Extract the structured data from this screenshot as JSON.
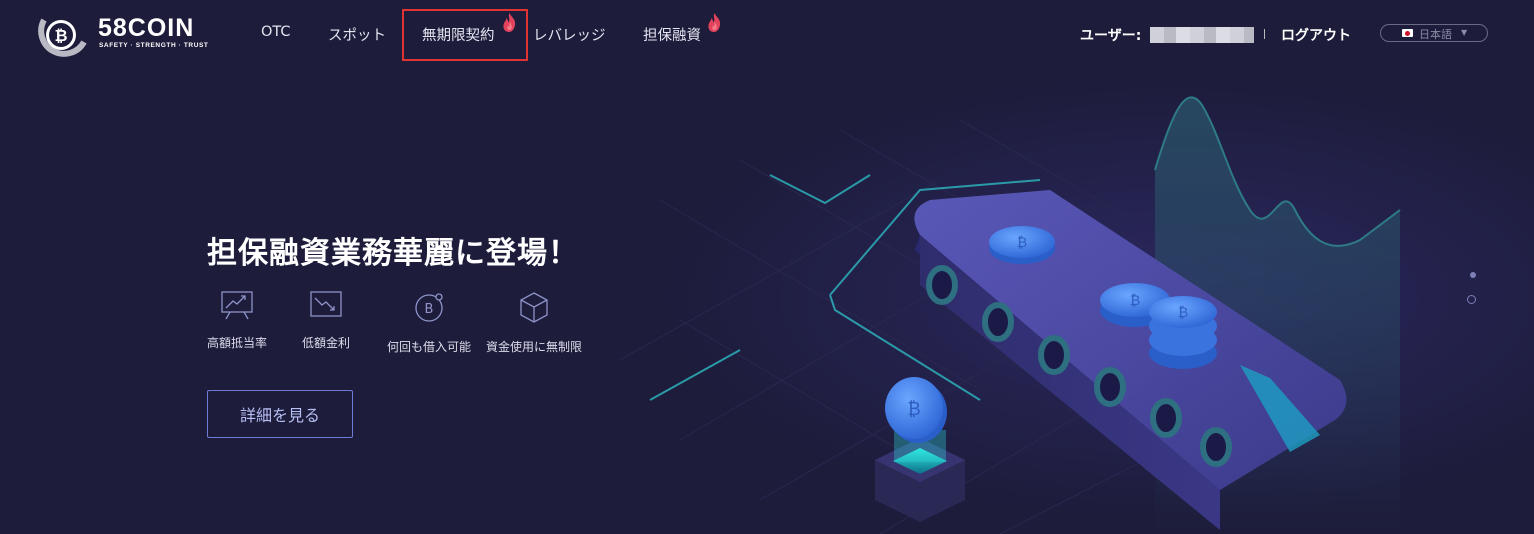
{
  "brand": {
    "name": "58COIN",
    "tagline": "SAFETY · STRENGTH · TRUST"
  },
  "nav": {
    "items": [
      {
        "label": "OTC"
      },
      {
        "label": "スポット"
      },
      {
        "label": "無期限契約",
        "hot": true,
        "highlighted": true
      },
      {
        "label": "レバレッジ"
      },
      {
        "label": "担保融資",
        "hot": true
      }
    ]
  },
  "user": {
    "label": "ユーザー:",
    "name_redacted": true,
    "logout_label": "ログアウト"
  },
  "language": {
    "selected": "日本語"
  },
  "hero": {
    "title": "担保融資業務華麗に登場！",
    "features": [
      {
        "icon": "chart-up-icon",
        "label": "高額抵当率"
      },
      {
        "icon": "chart-down-icon",
        "label": "低額金利"
      },
      {
        "icon": "bitcoin-cycle-icon",
        "label": "何回も借入可能"
      },
      {
        "icon": "cube-icon",
        "label": "資金使用に無制限"
      }
    ],
    "cta_label": "詳細を見る"
  },
  "carousel": {
    "slides": 2,
    "active": 2
  },
  "colors": {
    "background": "#1d1c3b",
    "accent": "#6f7bd4",
    "highlight_box": "#e03434",
    "fire": "#e2425b",
    "coin": "#3f7de6"
  }
}
